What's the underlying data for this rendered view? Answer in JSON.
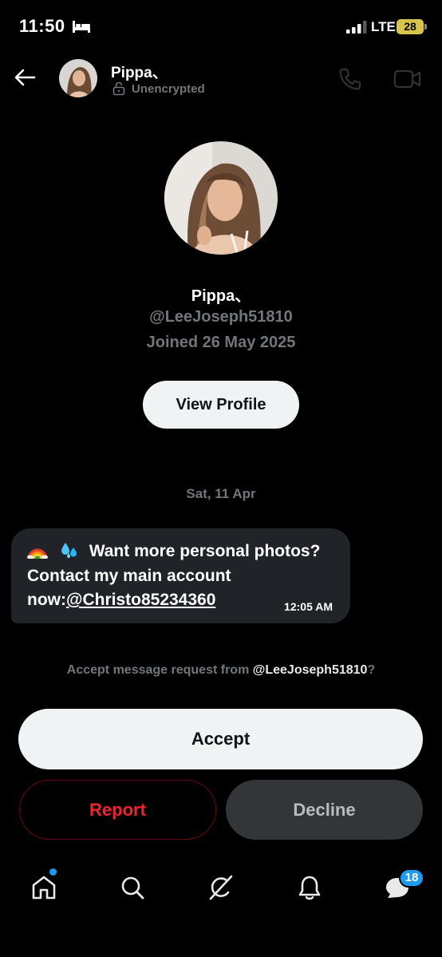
{
  "status_bar": {
    "time": "11:50",
    "network": "LTE",
    "battery": "28",
    "icons": [
      "bed-icon",
      "signal-icon"
    ]
  },
  "header": {
    "name": "Pippa、",
    "encryption_status": "Unencrypted",
    "icons": [
      "back-arrow-icon",
      "lock-icon",
      "phone-icon",
      "video-camera-icon"
    ]
  },
  "profile": {
    "name": "Pippa、",
    "handle": "@LeeJoseph51810",
    "joined": "Joined 26 May 2025",
    "view_profile_label": "View Profile"
  },
  "conversation": {
    "date_divider": "Sat, 11 Apr",
    "message": {
      "emoji_1": "🌈",
      "emoji_2": "💦",
      "line1": "Want more personal photos?",
      "line2": "Contact my main account",
      "line3_prefix": "now:",
      "mention": "@Christo85234360",
      "time": "12:05 AM"
    }
  },
  "request": {
    "prompt_prefix": "Accept message request from ",
    "prompt_handle": "@LeeJoseph51810",
    "prompt_suffix": "?",
    "accept_label": "Accept",
    "report_label": "Report",
    "decline_label": "Decline"
  },
  "bottom_nav": {
    "items": [
      "home-icon",
      "search-icon",
      "grok-icon",
      "notifications-icon",
      "messages-icon"
    ],
    "messages_badge": "18"
  },
  "colors": {
    "background": "#000000",
    "accent_blue": "#1d9bf0",
    "report_red": "#f4212e",
    "muted_text": "#71767b",
    "bubble": "#202327"
  }
}
